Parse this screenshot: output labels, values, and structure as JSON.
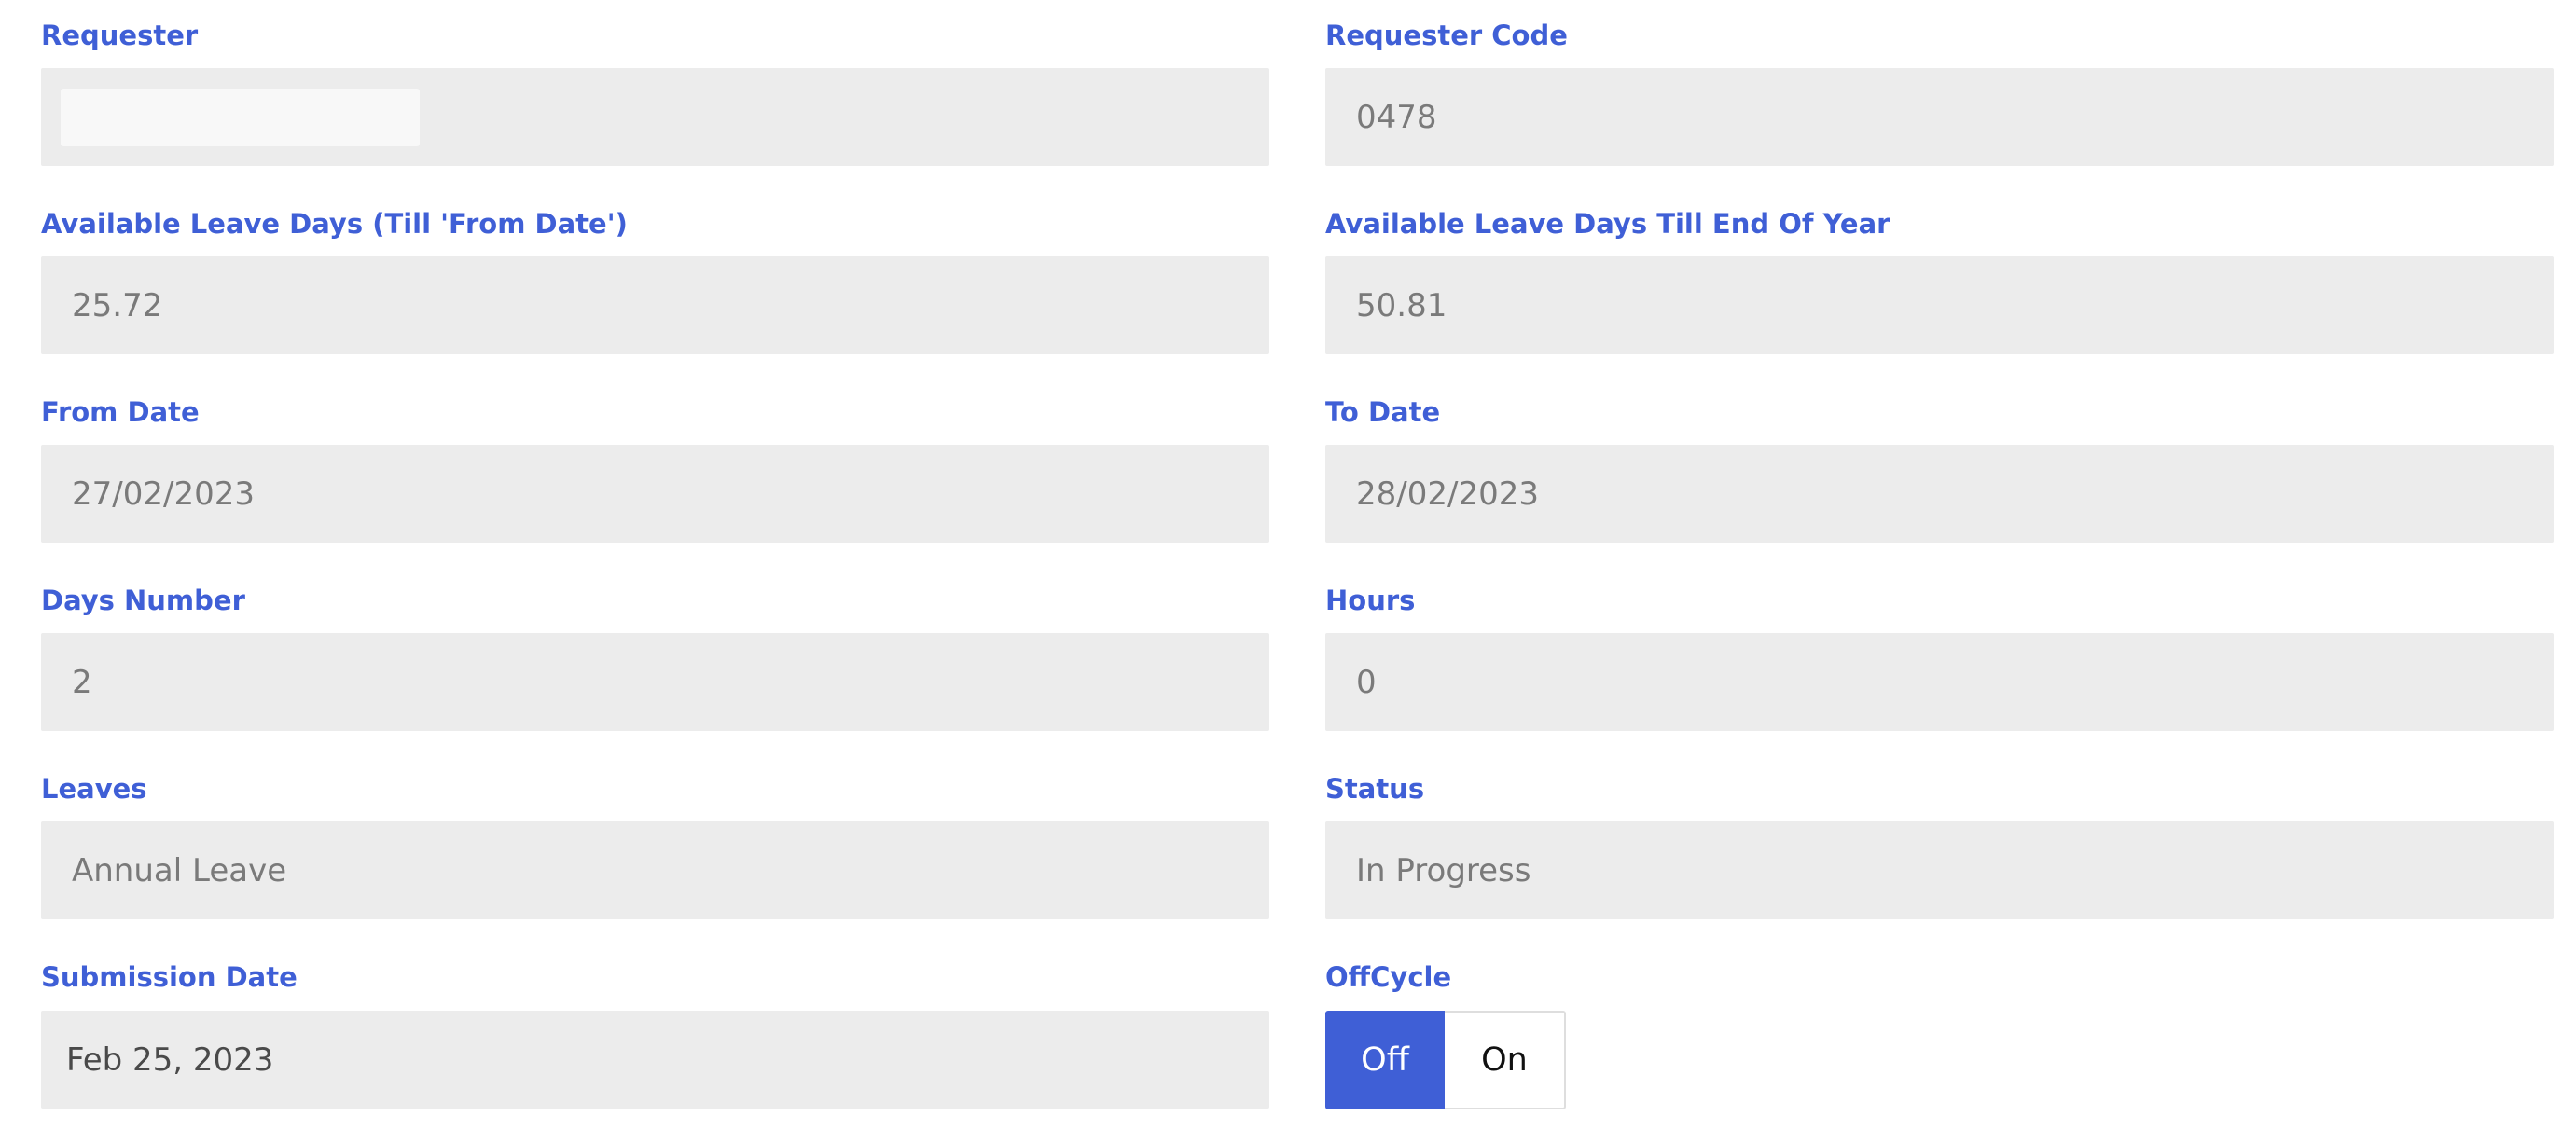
{
  "form": {
    "requester": {
      "label": "Requester",
      "value": ""
    },
    "requester_code": {
      "label": "Requester Code",
      "value": "0478"
    },
    "available_from": {
      "label": "Available Leave Days (Till 'From Date')",
      "value": "25.72"
    },
    "available_eoy": {
      "label": "Available Leave Days Till End Of Year",
      "value": "50.81"
    },
    "from_date": {
      "label": "From Date",
      "value": "27/02/2023"
    },
    "to_date": {
      "label": "To Date",
      "value": "28/02/2023"
    },
    "days_number": {
      "label": "Days Number",
      "value": "2"
    },
    "hours": {
      "label": "Hours",
      "value": "0"
    },
    "leaves": {
      "label": "Leaves",
      "value": "Annual Leave"
    },
    "status": {
      "label": "Status",
      "value": "In Progress"
    },
    "submission_date": {
      "label": "Submission Date",
      "value": "Feb 25, 2023"
    },
    "offcycle": {
      "label": "OffCycle",
      "off_label": "Off",
      "on_label": "On",
      "selected": "Off"
    }
  },
  "colors": {
    "accent": "#3f5fd6",
    "field_bg": "#ececec",
    "value_text": "#7a7a7a",
    "label_text": "#3f5fd6"
  }
}
